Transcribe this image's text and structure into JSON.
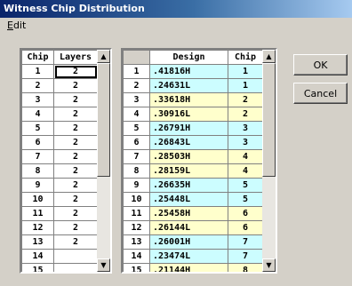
{
  "window": {
    "title": "Witness Chip Distribution"
  },
  "menu": {
    "edit_underline": "E",
    "edit_rest": "dit"
  },
  "left_table": {
    "headers": {
      "chip": "Chip",
      "layers": "Layers"
    },
    "rows": [
      {
        "chip": "1",
        "layers": "2"
      },
      {
        "chip": "2",
        "layers": "2"
      },
      {
        "chip": "3",
        "layers": "2"
      },
      {
        "chip": "4",
        "layers": "2"
      },
      {
        "chip": "5",
        "layers": "2"
      },
      {
        "chip": "6",
        "layers": "2"
      },
      {
        "chip": "7",
        "layers": "2"
      },
      {
        "chip": "8",
        "layers": "2"
      },
      {
        "chip": "9",
        "layers": "2"
      },
      {
        "chip": "10",
        "layers": "2"
      },
      {
        "chip": "11",
        "layers": "2"
      },
      {
        "chip": "12",
        "layers": "2"
      },
      {
        "chip": "13",
        "layers": "2"
      },
      {
        "chip": "14",
        "layers": ""
      },
      {
        "chip": "15",
        "layers": ""
      }
    ]
  },
  "right_table": {
    "headers": {
      "design": "Design",
      "chip": "Chip"
    },
    "rows": [
      {
        "num": "1",
        "design": ".41816H",
        "chip": "1",
        "color": "cyan"
      },
      {
        "num": "2",
        "design": ".24631L",
        "chip": "1",
        "color": "cyan"
      },
      {
        "num": "3",
        "design": ".33618H",
        "chip": "2",
        "color": "yellow"
      },
      {
        "num": "4",
        "design": ".30916L",
        "chip": "2",
        "color": "yellow"
      },
      {
        "num": "5",
        "design": ".26791H",
        "chip": "3",
        "color": "cyan"
      },
      {
        "num": "6",
        "design": ".26843L",
        "chip": "3",
        "color": "cyan"
      },
      {
        "num": "7",
        "design": ".28503H",
        "chip": "4",
        "color": "yellow"
      },
      {
        "num": "8",
        "design": ".28159L",
        "chip": "4",
        "color": "yellow"
      },
      {
        "num": "9",
        "design": ".26635H",
        "chip": "5",
        "color": "cyan"
      },
      {
        "num": "10",
        "design": ".25448L",
        "chip": "5",
        "color": "cyan"
      },
      {
        "num": "11",
        "design": ".25458H",
        "chip": "6",
        "color": "yellow"
      },
      {
        "num": "12",
        "design": ".26144L",
        "chip": "6",
        "color": "yellow"
      },
      {
        "num": "13",
        "design": ".26001H",
        "chip": "7",
        "color": "cyan"
      },
      {
        "num": "14",
        "design": ".23474L",
        "chip": "7",
        "color": "cyan"
      },
      {
        "num": "15",
        "design": ".21144H",
        "chip": "8",
        "color": "yellow"
      }
    ]
  },
  "buttons": {
    "ok": "OK",
    "cancel": "Cancel"
  },
  "icons": {
    "scroll_up": "scroll-up-arrow-icon",
    "scroll_down": "scroll-down-arrow-icon"
  },
  "colors": {
    "cyan": "#ccfdff",
    "yellow": "#ffffcc",
    "titlebar": "#0a246a"
  }
}
